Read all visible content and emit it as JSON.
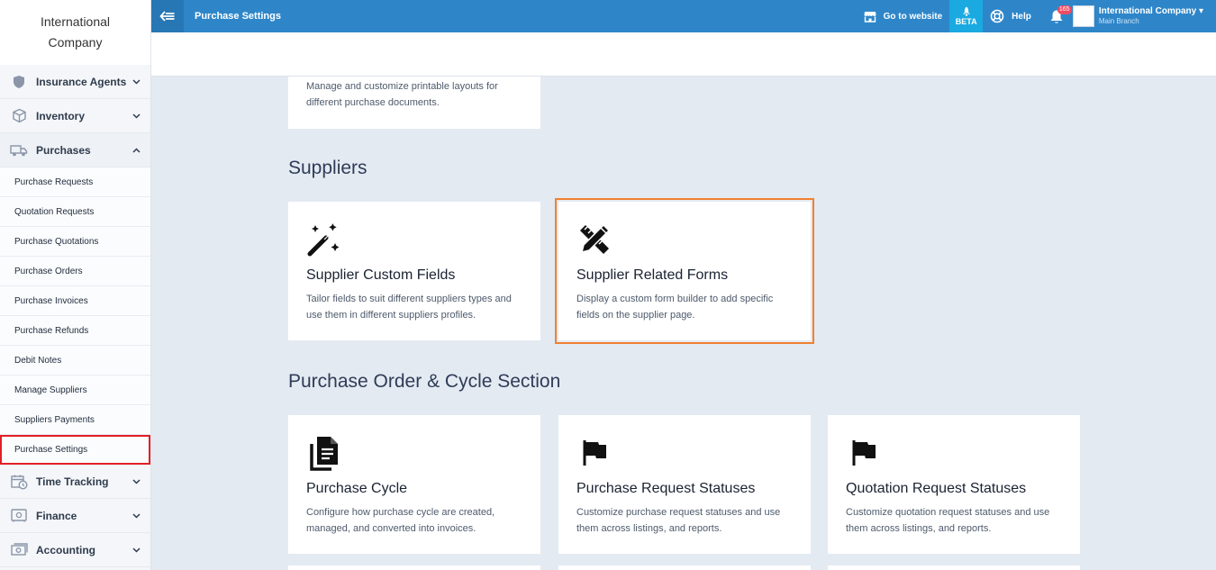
{
  "sidebar": {
    "brand": "International Company",
    "groups_top": [
      {
        "label": "Insurance Agents",
        "icon": "shield-icon"
      },
      {
        "label": "Inventory",
        "icon": "box-icon"
      },
      {
        "label": "Purchases",
        "icon": "truck-icon"
      }
    ],
    "sub_items": [
      "Purchase Requests",
      "Quotation Requests",
      "Purchase Quotations",
      "Purchase Orders",
      "Purchase Invoices",
      "Purchase Refunds",
      "Debit Notes",
      "Manage Suppliers",
      "Suppliers Payments",
      "Purchase Settings"
    ],
    "groups_bottom": [
      {
        "label": "Time Tracking",
        "icon": "calendar-clock-icon"
      },
      {
        "label": "Finance",
        "icon": "safe-icon"
      },
      {
        "label": "Accounting",
        "icon": "money-icon"
      }
    ]
  },
  "topbar": {
    "title": "Purchase Settings",
    "go_to_website": "Go to website",
    "beta": "BETA",
    "help": "Help",
    "notifications_count": "165",
    "company": "International Company",
    "branch": "Main Branch"
  },
  "content": {
    "partial_card_desc": "Manage and customize printable layouts for different purchase documents.",
    "sections": [
      {
        "title": "Suppliers",
        "cards": [
          {
            "title": "Supplier Custom Fields",
            "desc": "Tailor fields to suit different suppliers types and use them in different suppliers profiles.",
            "icon": "magic-wand-icon"
          },
          {
            "title": "Supplier Related Forms",
            "desc": "Display a custom form builder to add specific fields on the supplier page.",
            "icon": "pencil-ruler-icon"
          }
        ]
      },
      {
        "title": "Purchase Order & Cycle Section",
        "cards": [
          {
            "title": "Purchase Cycle",
            "desc": "Configure how purchase cycle are created, managed, and converted into invoices.",
            "icon": "documents-icon"
          },
          {
            "title": "Purchase Request Statuses",
            "desc": "Customize purchase request statuses and use them across listings, and reports.",
            "icon": "flag-icon"
          },
          {
            "title": "Quotation Request Statuses",
            "desc": "Customize quotation request statuses and use them across listings, and reports.",
            "icon": "flag-icon"
          }
        ]
      }
    ]
  },
  "colors": {
    "topbar": "#2e86c9",
    "beta": "#1aa9e1",
    "highlight": "#f08130",
    "active_outline": "#e21f26"
  }
}
